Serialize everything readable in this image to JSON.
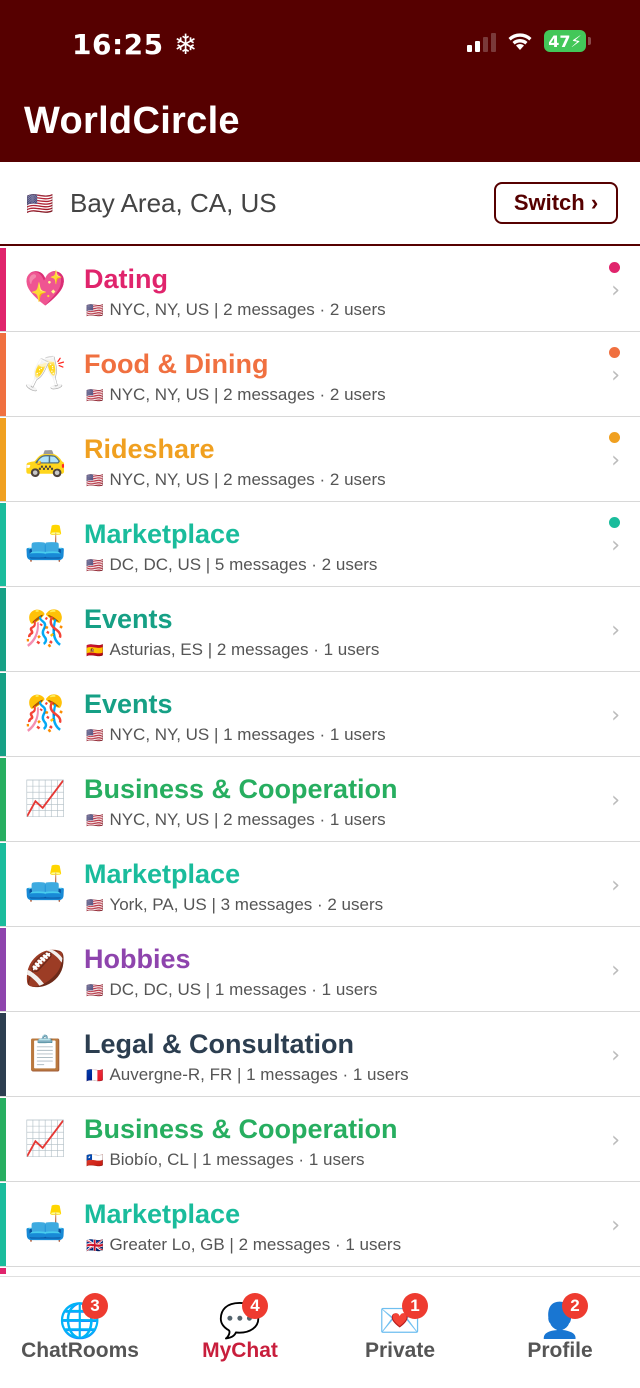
{
  "status_bar": {
    "time": "16:25",
    "battery": "47"
  },
  "app": {
    "title": "WorldCircle"
  },
  "location": {
    "flag": "🇺🇸",
    "text": "Bay Area, CA, US",
    "switch_label": "Switch ›"
  },
  "rooms": [
    {
      "icon": "💖",
      "icon_name": "sparkling-heart-icon",
      "title": "Dating",
      "color": "#e0246c",
      "flag": "🇺🇸",
      "subtitle": "NYC, NY, US | 2 messages · 2 users",
      "unread": true
    },
    {
      "icon": "🥂",
      "icon_name": "clinking-glasses-icon",
      "title": "Food & Dining",
      "color": "#f07040",
      "flag": "🇺🇸",
      "subtitle": "NYC, NY, US | 2 messages · 2 users",
      "unread": true
    },
    {
      "icon": "🚕",
      "icon_name": "taxi-icon",
      "title": "Rideshare",
      "color": "#f0a020",
      "flag": "🇺🇸",
      "subtitle": "NYC, NY, US | 2 messages · 2 users",
      "unread": true
    },
    {
      "icon": "🛋️",
      "icon_name": "couch-lamp-icon",
      "title": "Marketplace",
      "color": "#1abc9c",
      "flag": "🇺🇸",
      "subtitle": "DC, DC, US | 5 messages · 2 users",
      "unread": true
    },
    {
      "icon": "🎊",
      "icon_name": "confetti-ball-icon",
      "title": "Events",
      "color": "#16a085",
      "flag": "🇪🇸",
      "subtitle": "Asturias, ES | 2 messages · 1 users",
      "unread": false
    },
    {
      "icon": "🎊",
      "icon_name": "confetti-ball-icon",
      "title": "Events",
      "color": "#16a085",
      "flag": "🇺🇸",
      "subtitle": "NYC, NY, US | 1 messages · 1 users",
      "unread": false
    },
    {
      "icon": "📈",
      "icon_name": "chart-increasing-icon",
      "title": "Business & Cooperation",
      "color": "#27ae60",
      "flag": "🇺🇸",
      "subtitle": "NYC, NY, US | 2 messages · 1 users",
      "unread": false
    },
    {
      "icon": "🛋️",
      "icon_name": "couch-lamp-icon",
      "title": "Marketplace",
      "color": "#1abc9c",
      "flag": "🇺🇸",
      "subtitle": "York, PA, US | 3 messages · 2 users",
      "unread": false
    },
    {
      "icon": "🏈",
      "icon_name": "football-icon",
      "title": "Hobbies",
      "color": "#8e44ad",
      "flag": "🇺🇸",
      "subtitle": "DC, DC, US | 1 messages · 1 users",
      "unread": false
    },
    {
      "icon": "📋",
      "icon_name": "clipboard-icon",
      "title": "Legal & Consultation",
      "color": "#2c3e50",
      "flag": "🇫🇷",
      "subtitle": "Auvergne-R, FR | 1 messages · 1 users",
      "unread": false
    },
    {
      "icon": "📈",
      "icon_name": "chart-increasing-icon",
      "title": "Business & Cooperation",
      "color": "#27ae60",
      "flag": "🇨🇱",
      "subtitle": "Biobío, CL | 1 messages · 1 users",
      "unread": false
    },
    {
      "icon": "🛋️",
      "icon_name": "couch-lamp-icon",
      "title": "Marketplace",
      "color": "#1abc9c",
      "flag": "🇬🇧",
      "subtitle": "Greater Lo, GB | 2 messages · 1 users",
      "unread": false
    },
    {
      "icon": "",
      "icon_name": "",
      "title": "",
      "color": "#e0246c",
      "flag": "",
      "subtitle": "",
      "unread": false
    }
  ],
  "tabs": [
    {
      "icon": "🌐",
      "icon_name": "globe-icon",
      "label": "ChatRooms",
      "badge": "3",
      "active": false
    },
    {
      "icon": "💬",
      "icon_name": "chat-bubbles-icon",
      "label": "MyChat",
      "badge": "4",
      "active": true
    },
    {
      "icon": "💌",
      "icon_name": "love-letter-icon",
      "label": "Private",
      "badge": "1",
      "active": false
    },
    {
      "icon": "👤",
      "icon_name": "person-silhouette-icon",
      "label": "Profile",
      "badge": "2",
      "active": false
    }
  ]
}
